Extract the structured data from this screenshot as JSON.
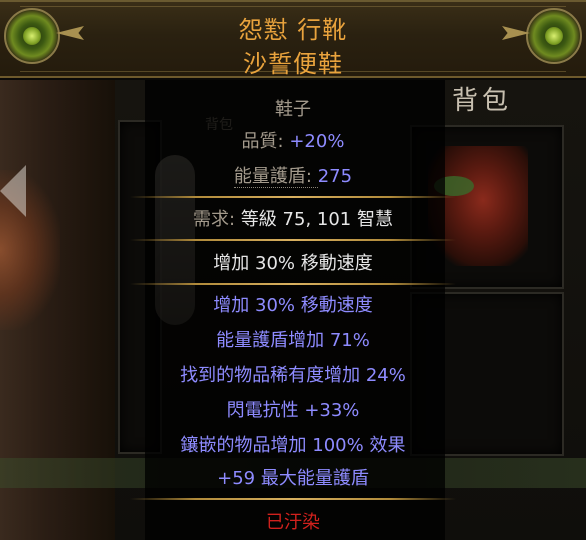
{
  "header": {
    "name": "怨懟 行靴",
    "base": "沙誓便鞋"
  },
  "background": {
    "inventory_title": "背包",
    "inventory_small": "背包"
  },
  "item": {
    "category": "鞋子",
    "quality_label": "品質: ",
    "quality_value": "+20%",
    "es_label": "能量護盾: ",
    "es_value": "275",
    "requirement_label": "需求: ",
    "requirement_level": "等級 75, 101 智慧",
    "implicit": "增加 30% 移動速度",
    "explicit_mods": [
      "增加 30% 移動速度",
      "能量護盾增加 71%",
      "找到的物品稀有度增加 24%",
      "閃電抗性 +33%",
      "鑲嵌的物品增加 100% 效果",
      "+59 最大能量護盾"
    ],
    "corrupted": "已汙染"
  },
  "colors": {
    "title": "#e9a33d",
    "grey": "#a39a8c",
    "magic_blue": "#8e8bff",
    "white": "#e6e6e6",
    "corrupted": "#d0211d",
    "separator": "#d8b060"
  }
}
